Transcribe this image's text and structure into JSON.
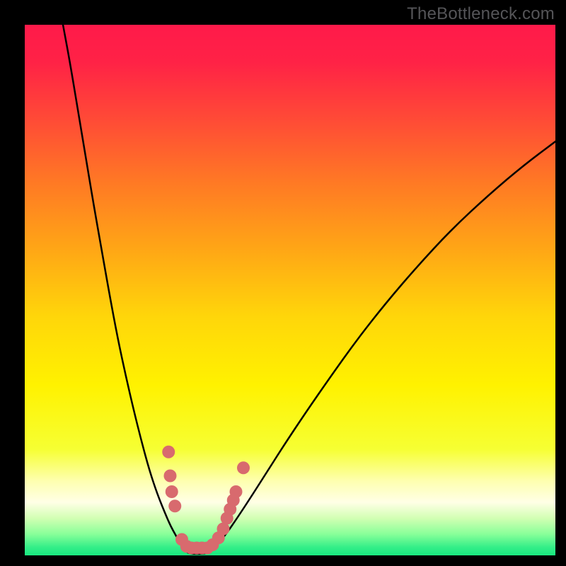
{
  "watermark": "TheBottleneck.com",
  "chart_data": {
    "type": "line",
    "title": "",
    "xlabel": "",
    "ylabel": "",
    "xlim": [
      0,
      100
    ],
    "ylim": [
      0,
      100
    ],
    "grid": false,
    "legend": false,
    "background_gradient_stops": [
      {
        "offset": 0.0,
        "color": "#ff1a4a"
      },
      {
        "offset": 0.07,
        "color": "#ff2246"
      },
      {
        "offset": 0.18,
        "color": "#ff4b36"
      },
      {
        "offset": 0.3,
        "color": "#ff7a24"
      },
      {
        "offset": 0.42,
        "color": "#ffa516"
      },
      {
        "offset": 0.55,
        "color": "#ffd60a"
      },
      {
        "offset": 0.68,
        "color": "#fff200"
      },
      {
        "offset": 0.8,
        "color": "#f6ff33"
      },
      {
        "offset": 0.86,
        "color": "#feffb0"
      },
      {
        "offset": 0.9,
        "color": "#ffffe6"
      },
      {
        "offset": 0.93,
        "color": "#d2ffb3"
      },
      {
        "offset": 0.96,
        "color": "#88ff99"
      },
      {
        "offset": 0.985,
        "color": "#33ee88"
      },
      {
        "offset": 1.0,
        "color": "#18e880"
      }
    ],
    "series": [
      {
        "name": "bottleneck-curve-left",
        "x": [
          7.2,
          8.5,
          10.0,
          11.5,
          13.0,
          14.5,
          16.0,
          17.5,
          19.0,
          20.5,
          22.0,
          23.5,
          25.0,
          26.5,
          27.5,
          28.5,
          29.3,
          30.0,
          30.8
        ],
        "y": [
          100.0,
          93.0,
          84.0,
          75.0,
          66.0,
          57.5,
          49.0,
          41.0,
          34.0,
          27.5,
          21.5,
          16.0,
          11.5,
          7.8,
          5.5,
          3.7,
          2.3,
          1.2,
          0.5
        ]
      },
      {
        "name": "bottleneck-curve-right",
        "x": [
          34.5,
          35.5,
          36.5,
          38.0,
          40.0,
          42.5,
          45.5,
          49.0,
          53.0,
          57.5,
          62.5,
          68.0,
          74.0,
          80.5,
          87.5,
          94.0,
          100.0
        ],
        "y": [
          0.5,
          1.2,
          2.3,
          4.1,
          7.0,
          10.8,
          15.5,
          21.0,
          27.0,
          33.5,
          40.5,
          47.5,
          54.5,
          61.5,
          68.0,
          73.5,
          78.0
        ]
      },
      {
        "name": "valley-floor",
        "x": [
          30.8,
          31.5,
          32.5,
          33.5,
          34.5
        ],
        "y": [
          0.5,
          0.3,
          0.3,
          0.3,
          0.5
        ]
      }
    ],
    "markers": {
      "name": "salmon-dots",
      "color": "#d86a6e",
      "radius_px": 9,
      "points": [
        {
          "x": 27.1,
          "y": 19.5
        },
        {
          "x": 27.4,
          "y": 15.0
        },
        {
          "x": 27.7,
          "y": 12.0
        },
        {
          "x": 28.3,
          "y": 9.3
        },
        {
          "x": 29.6,
          "y": 3.0
        },
        {
          "x": 30.5,
          "y": 1.7
        },
        {
          "x": 31.4,
          "y": 1.4
        },
        {
          "x": 32.4,
          "y": 1.4
        },
        {
          "x": 33.4,
          "y": 1.4
        },
        {
          "x": 34.4,
          "y": 1.4
        },
        {
          "x": 35.4,
          "y": 2.0
        },
        {
          "x": 36.5,
          "y": 3.3
        },
        {
          "x": 37.4,
          "y": 5.0
        },
        {
          "x": 38.1,
          "y": 7.0
        },
        {
          "x": 38.7,
          "y": 8.7
        },
        {
          "x": 39.3,
          "y": 10.4
        },
        {
          "x": 39.8,
          "y": 12.0
        },
        {
          "x": 41.2,
          "y": 16.5
        }
      ]
    }
  }
}
